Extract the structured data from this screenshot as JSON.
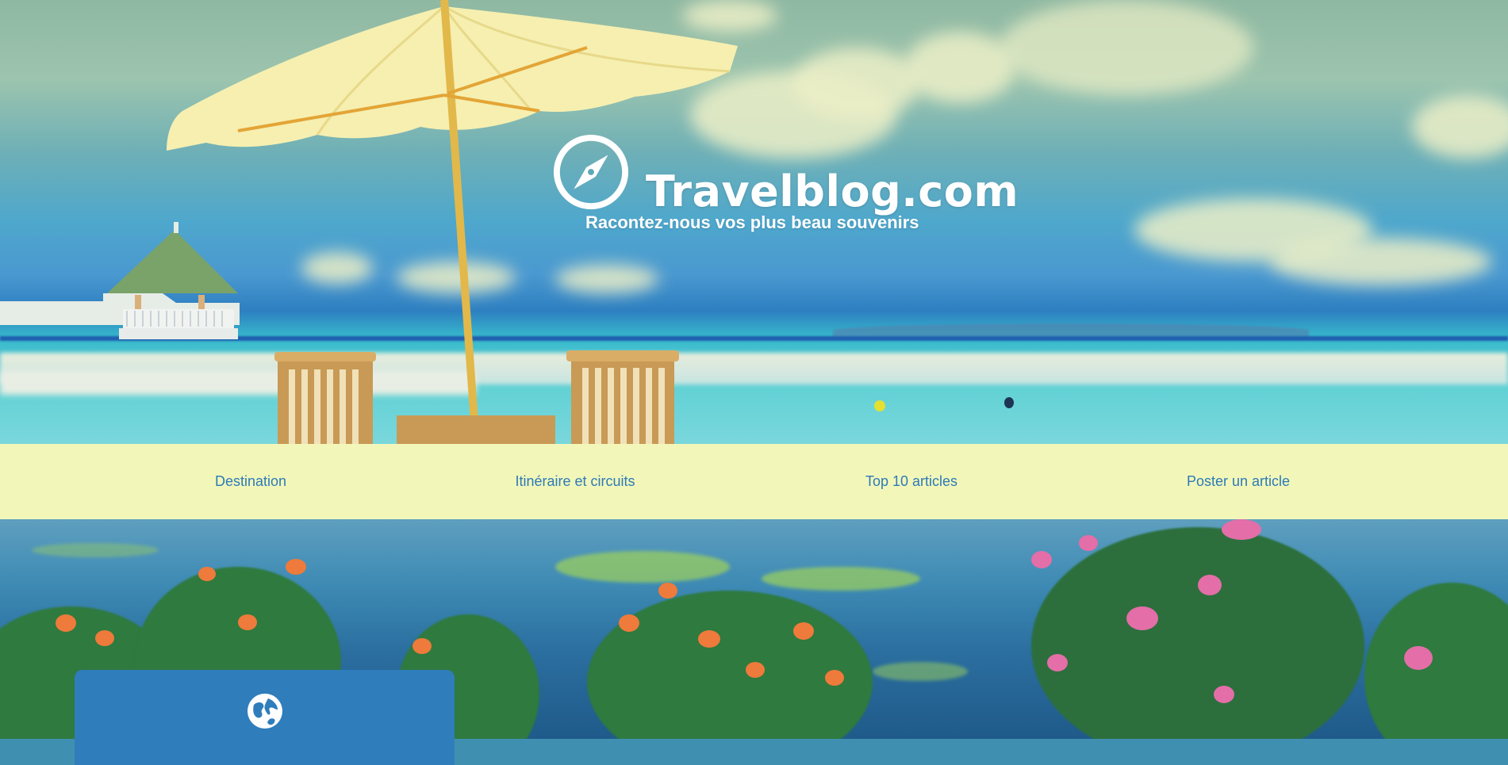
{
  "site": {
    "title": "Travelblog.com",
    "tagline": "Racontez-nous vos plus beau souvenirs",
    "logo_icon": "compass-icon"
  },
  "nav": {
    "items": [
      {
        "label": "Destination"
      },
      {
        "label": "Itinéraire et circuits"
      },
      {
        "label": "Top 10 articles"
      },
      {
        "label": "Poster un article"
      }
    ]
  },
  "card": {
    "icon": "globe-icon"
  },
  "colors": {
    "nav_background": "#f2f7b9",
    "nav_text": "#2d7ab8",
    "card_background": "#2f7dbb"
  }
}
